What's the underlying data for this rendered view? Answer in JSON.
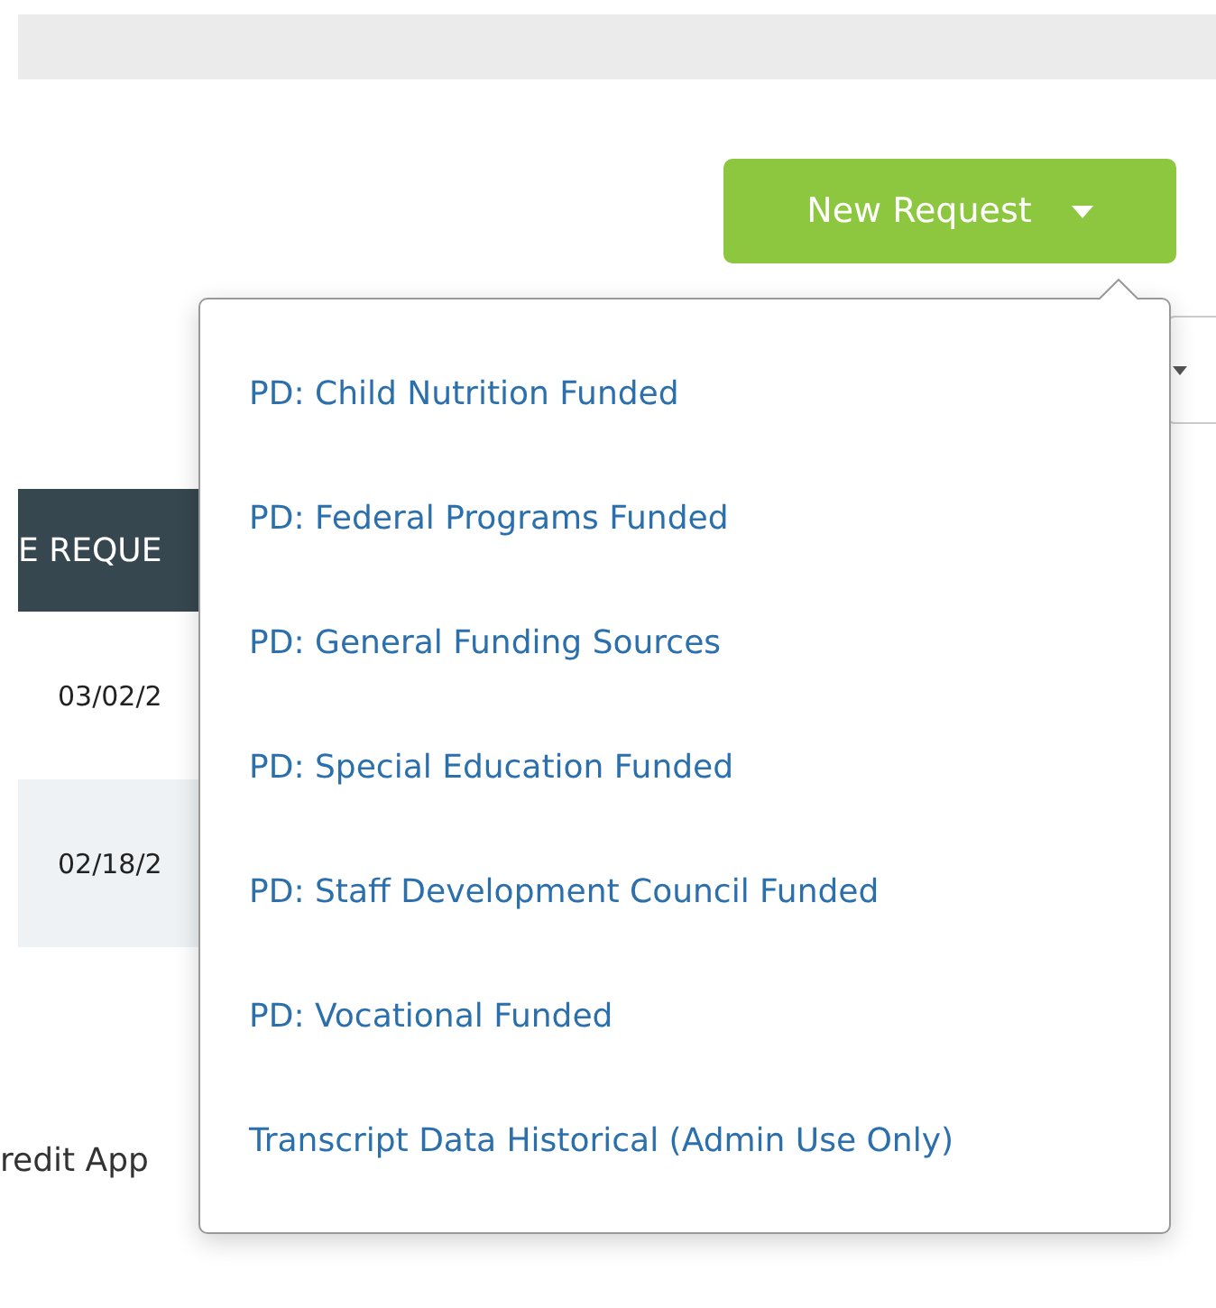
{
  "new_request_button": {
    "label": "New Request"
  },
  "menu": {
    "items": [
      {
        "label": "PD: Child Nutrition Funded"
      },
      {
        "label": "PD: Federal Programs Funded"
      },
      {
        "label": "PD: General Funding Sources"
      },
      {
        "label": "PD: Special Education Funded"
      },
      {
        "label": "PD: Staff Development Council Funded"
      },
      {
        "label": "PD: Vocational Funded"
      },
      {
        "label": "Transcript Data Historical (Admin Use Only)"
      }
    ]
  },
  "table": {
    "header": "E REQUE",
    "rows": [
      {
        "cell": "03/02/2"
      },
      {
        "cell": "02/18/2"
      }
    ]
  },
  "footer_text": "redit App"
}
